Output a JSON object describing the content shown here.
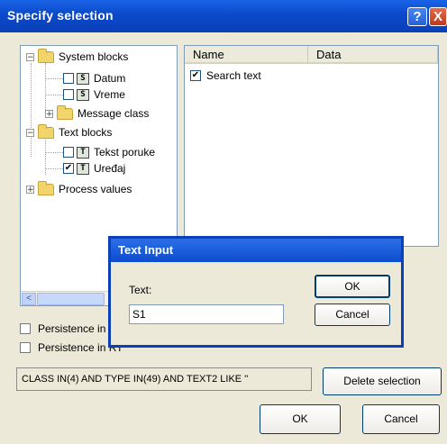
{
  "window": {
    "title": "Specify selection",
    "help_icon": "?",
    "close_icon": "X"
  },
  "tree": {
    "items": [
      {
        "label": "System blocks",
        "expander": "−"
      },
      {
        "label": "Datum",
        "checked": false,
        "icon_glyph": "S"
      },
      {
        "label": "Vreme",
        "checked": false,
        "icon_glyph": "S"
      },
      {
        "label": "Message class",
        "expander": "+"
      },
      {
        "label": "Text blocks",
        "expander": "−"
      },
      {
        "label": "Tekst poruke",
        "checked": false,
        "icon_glyph": "T"
      },
      {
        "label": "Uređaj",
        "checked": true,
        "icon_glyph": "T"
      },
      {
        "label": "Process values",
        "expander": "+"
      }
    ],
    "scroll_left_icon": "<"
  },
  "list": {
    "columns": [
      "Name",
      "Data"
    ],
    "rows": [
      {
        "name": "Search text",
        "checked": true,
        "data": ""
      }
    ]
  },
  "checkboxes": [
    {
      "label": "Persistence in",
      "checked": false
    },
    {
      "label": "Persistence in RT",
      "checked": false
    }
  ],
  "query_text": "CLASS IN(4) AND TYPE IN(49) AND TEXT2 LIKE '' ",
  "buttons": {
    "delete_selection": "Delete selection",
    "ok": "OK",
    "cancel": "Cancel"
  },
  "text_input_dialog": {
    "title": "Text Input",
    "field_label": "Text:",
    "field_value": "S1",
    "ok": "OK",
    "cancel": "Cancel"
  },
  "colors": {
    "title_blue": "#0b49c9",
    "face": "#ece9d8",
    "border": "#7f9db9"
  }
}
